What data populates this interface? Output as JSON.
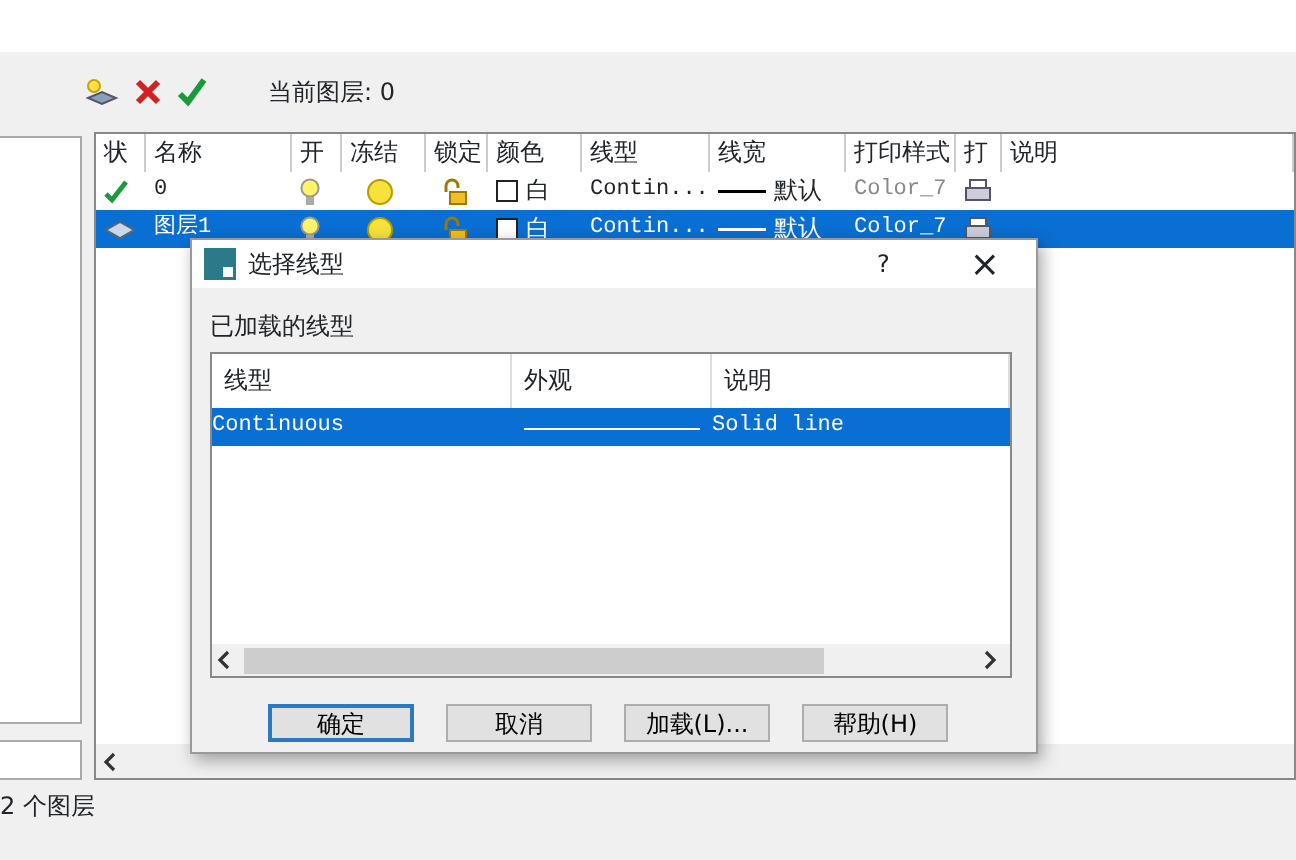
{
  "toolbar": {
    "current_layer": "当前图层: 0"
  },
  "layer_table": {
    "columns": [
      "状",
      "名称",
      "开",
      "冻结",
      "锁定",
      "颜色",
      "线型",
      "线宽",
      "打印样式",
      "打",
      "说明"
    ],
    "rows": [
      {
        "kind": "current",
        "name": "0",
        "selected": false,
        "on": true,
        "frozen": false,
        "locked": false,
        "color_name": "白",
        "linetype": "Contin...",
        "lineweight": "默认",
        "plot_style": "Color_7"
      },
      {
        "kind": "layer",
        "name": "图层1",
        "selected": true,
        "on": true,
        "frozen": false,
        "locked": false,
        "color_name": "白",
        "linetype": "Contin...",
        "lineweight": "默认",
        "plot_style": "Color_7"
      }
    ]
  },
  "status_bar": {
    "layer_count": "2 个图层"
  },
  "dialog": {
    "title": "选择线型",
    "help": "?",
    "close": "×",
    "section_label": "已加载的线型",
    "columns": [
      "线型",
      "外观",
      "说明"
    ],
    "rows": [
      {
        "linetype": "Continuous",
        "description": "Solid line",
        "selected": true
      }
    ],
    "buttons": [
      {
        "label": "确定",
        "default": true
      },
      {
        "label": "取消",
        "default": false
      },
      {
        "label": "加载(L)...",
        "default": false
      },
      {
        "label": "帮助(H)",
        "default": false
      }
    ]
  }
}
